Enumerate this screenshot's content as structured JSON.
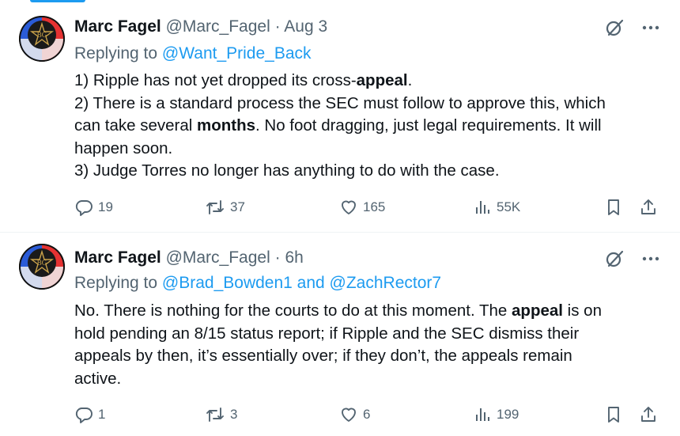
{
  "tweets": [
    {
      "author_name": "Marc Fagel",
      "handle": "@Marc_Fagel",
      "separator": "·",
      "time": "Aug 3",
      "replying_prefix": "Replying to",
      "replying_mentions": "@Want_Pride_Back",
      "body_lines": [
        {
          "pre": "1) Ripple has not yet dropped its cross-",
          "bold": "appeal",
          "post": "."
        },
        {
          "pre": "2) There is a standard process the SEC must follow to approve this, which",
          "bold": "",
          "post": ""
        },
        {
          "pre": "can take several ",
          "bold": "months",
          "post": ". No foot dragging, just legal requirements. It will"
        },
        {
          "pre": "happen soon.",
          "bold": "",
          "post": ""
        },
        {
          "pre": "3) Judge Torres no longer has anything to do with the case.",
          "bold": "",
          "post": ""
        }
      ],
      "replies": "19",
      "reposts": "37",
      "likes": "165",
      "views": "55K"
    },
    {
      "author_name": "Marc Fagel",
      "handle": "@Marc_Fagel",
      "separator": "·",
      "time": "6h",
      "replying_prefix": "Replying to",
      "replying_mentions": "@Brad_Bowden1 and @ZachRector7",
      "body_lines": [
        {
          "pre": "No. There is nothing for the courts to do at this moment. The ",
          "bold": "appeal",
          "post": " is on"
        },
        {
          "pre": "hold pending an 8/15 status report; if Ripple and the SEC dismiss their",
          "bold": "",
          "post": ""
        },
        {
          "pre": "appeals by then, it’s essentially over; if they don’t, the appeals remain",
          "bold": "",
          "post": ""
        },
        {
          "pre": "active.",
          "bold": "",
          "post": ""
        }
      ],
      "replies": "1",
      "reposts": "3",
      "likes": "6",
      "views": "199"
    }
  ],
  "icons": {
    "grok": "grok-icon",
    "more": "more-dots-icon",
    "reply": "reply-bubble-icon",
    "repost": "repost-arrows-icon",
    "like": "heart-icon",
    "views": "views-bar-chart-icon",
    "bookmark": "bookmark-icon",
    "share": "share-upload-icon"
  },
  "colors": {
    "link": "#1d9bf0",
    "secondary_text": "#536471",
    "primary_text": "#0f1419"
  }
}
